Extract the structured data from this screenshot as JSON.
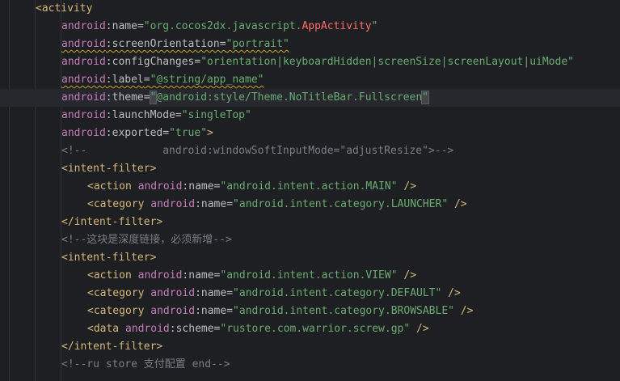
{
  "editor": {
    "colors": {
      "background": "#1e1f22",
      "current_line": "#26282e",
      "tag": "#d5b778",
      "namespace": "#c77dbb",
      "attribute": "#bcbec4",
      "string": "#6aab73",
      "special_string": "#ff6b68",
      "comment": "#7a7e85",
      "warning_underline": "#c9a42a"
    },
    "lines": [
      [
        {
          "text": "<",
          "c": "tag"
        },
        {
          "text": "activity",
          "c": "tag"
        }
      ],
      [
        {
          "text": "android",
          "c": "ns"
        },
        {
          "text": ":",
          "c": "punct"
        },
        {
          "text": "name",
          "c": "attr"
        },
        {
          "text": "=",
          "c": "punct"
        },
        {
          "text": "\"org.cocos2dx.javascript.",
          "c": "str"
        },
        {
          "text": "AppActivity",
          "c": "special"
        },
        {
          "text": "\"",
          "c": "str"
        }
      ],
      [
        {
          "text": "android",
          "c": "ns",
          "deprecated": true,
          "warn": true
        },
        {
          "text": ":",
          "c": "punct",
          "deprecated": true,
          "warn": true
        },
        {
          "text": "screenOrientation",
          "c": "attr",
          "deprecated": true,
          "warn": true
        },
        {
          "text": "=",
          "c": "punct",
          "deprecated": true,
          "warn": true
        },
        {
          "text": "\"portrait\"",
          "c": "str",
          "deprecated": true,
          "warn": true
        }
      ],
      [
        {
          "text": "android",
          "c": "ns"
        },
        {
          "text": ":",
          "c": "punct"
        },
        {
          "text": "configChanges",
          "c": "attr"
        },
        {
          "text": "=",
          "c": "punct"
        },
        {
          "text": "\"orientation|keyboardHidden|screenSize|screenLayout|uiMode\"",
          "c": "str"
        }
      ],
      [
        {
          "text": "android",
          "c": "ns",
          "warn": true
        },
        {
          "text": ":",
          "c": "punct",
          "warn": true
        },
        {
          "text": "label",
          "c": "attr",
          "warn": true
        },
        {
          "text": "=",
          "c": "punct",
          "warn": true
        },
        {
          "text": "\"@string/app_name\"",
          "c": "str",
          "warn": true
        }
      ],
      [
        {
          "text": "android",
          "c": "ns"
        },
        {
          "text": ":",
          "c": "punct"
        },
        {
          "text": "theme",
          "c": "attr"
        },
        {
          "text": "=",
          "c": "punct"
        },
        {
          "text": "\"",
          "c": "str",
          "match": true
        },
        {
          "text": "@android:style/Theme.NoTitleBar.Fullscreen",
          "c": "str"
        },
        {
          "text": "\"",
          "c": "str",
          "match": true
        }
      ],
      [
        {
          "text": "android",
          "c": "ns"
        },
        {
          "text": ":",
          "c": "punct"
        },
        {
          "text": "launchMode",
          "c": "attr"
        },
        {
          "text": "=",
          "c": "punct"
        },
        {
          "text": "\"singleTop\"",
          "c": "str"
        }
      ],
      [
        {
          "text": "android",
          "c": "ns"
        },
        {
          "text": ":",
          "c": "punct"
        },
        {
          "text": "exported",
          "c": "attr"
        },
        {
          "text": "=",
          "c": "punct"
        },
        {
          "text": "\"true\"",
          "c": "str"
        },
        {
          "text": ">",
          "c": "tag"
        }
      ],
      [
        {
          "text": "<!--            android:windowSoftInputMode=\"adjustResize\">-->",
          "c": "comment"
        }
      ],
      [
        {
          "text": "<intent-filter>",
          "c": "tag"
        }
      ],
      [
        {
          "text": "<action ",
          "c": "tag"
        },
        {
          "text": "android",
          "c": "ns"
        },
        {
          "text": ":",
          "c": "punct"
        },
        {
          "text": "name",
          "c": "attr"
        },
        {
          "text": "=",
          "c": "punct"
        },
        {
          "text": "\"android.intent.action.MAIN\"",
          "c": "str"
        },
        {
          "text": " />",
          "c": "tag"
        }
      ],
      [
        {
          "text": "<category ",
          "c": "tag"
        },
        {
          "text": "android",
          "c": "ns"
        },
        {
          "text": ":",
          "c": "punct"
        },
        {
          "text": "name",
          "c": "attr"
        },
        {
          "text": "=",
          "c": "punct"
        },
        {
          "text": "\"android.intent.category.LAUNCHER\"",
          "c": "str"
        },
        {
          "text": " />",
          "c": "tag"
        }
      ],
      [
        {
          "text": "</intent-filter>",
          "c": "tag"
        }
      ],
      [
        {
          "text": "<!--这块是深度链接，必须新增-->",
          "c": "comment"
        }
      ],
      [
        {
          "text": "<intent-filter>",
          "c": "tag"
        }
      ],
      [
        {
          "text": "<action ",
          "c": "tag"
        },
        {
          "text": "android",
          "c": "ns"
        },
        {
          "text": ":",
          "c": "punct"
        },
        {
          "text": "name",
          "c": "attr"
        },
        {
          "text": "=",
          "c": "punct"
        },
        {
          "text": "\"android.intent.action.VIEW\"",
          "c": "str"
        },
        {
          "text": " />",
          "c": "tag"
        }
      ],
      [
        {
          "text": "<category ",
          "c": "tag"
        },
        {
          "text": "android",
          "c": "ns"
        },
        {
          "text": ":",
          "c": "punct"
        },
        {
          "text": "name",
          "c": "attr"
        },
        {
          "text": "=",
          "c": "punct"
        },
        {
          "text": "\"android.intent.category.DEFAULT\"",
          "c": "str"
        },
        {
          "text": " />",
          "c": "tag"
        }
      ],
      [
        {
          "text": "<category ",
          "c": "tag"
        },
        {
          "text": "android",
          "c": "ns"
        },
        {
          "text": ":",
          "c": "punct"
        },
        {
          "text": "name",
          "c": "attr"
        },
        {
          "text": "=",
          "c": "punct"
        },
        {
          "text": "\"android.intent.category.BROWSABLE\"",
          "c": "str"
        },
        {
          "text": " />",
          "c": "tag"
        }
      ],
      [
        {
          "text": "<data ",
          "c": "tag"
        },
        {
          "text": "android",
          "c": "ns"
        },
        {
          "text": ":",
          "c": "punct"
        },
        {
          "text": "scheme",
          "c": "attr"
        },
        {
          "text": "=",
          "c": "punct"
        },
        {
          "text": "\"rustore.com.warrior.screw.gp\"",
          "c": "str"
        },
        {
          "text": " />",
          "c": "tag"
        }
      ],
      [
        {
          "text": "</intent-filter>",
          "c": "tag"
        }
      ],
      [
        {
          "text": "<!--ru store 支付配置 end-->",
          "c": "comment"
        }
      ]
    ]
  }
}
